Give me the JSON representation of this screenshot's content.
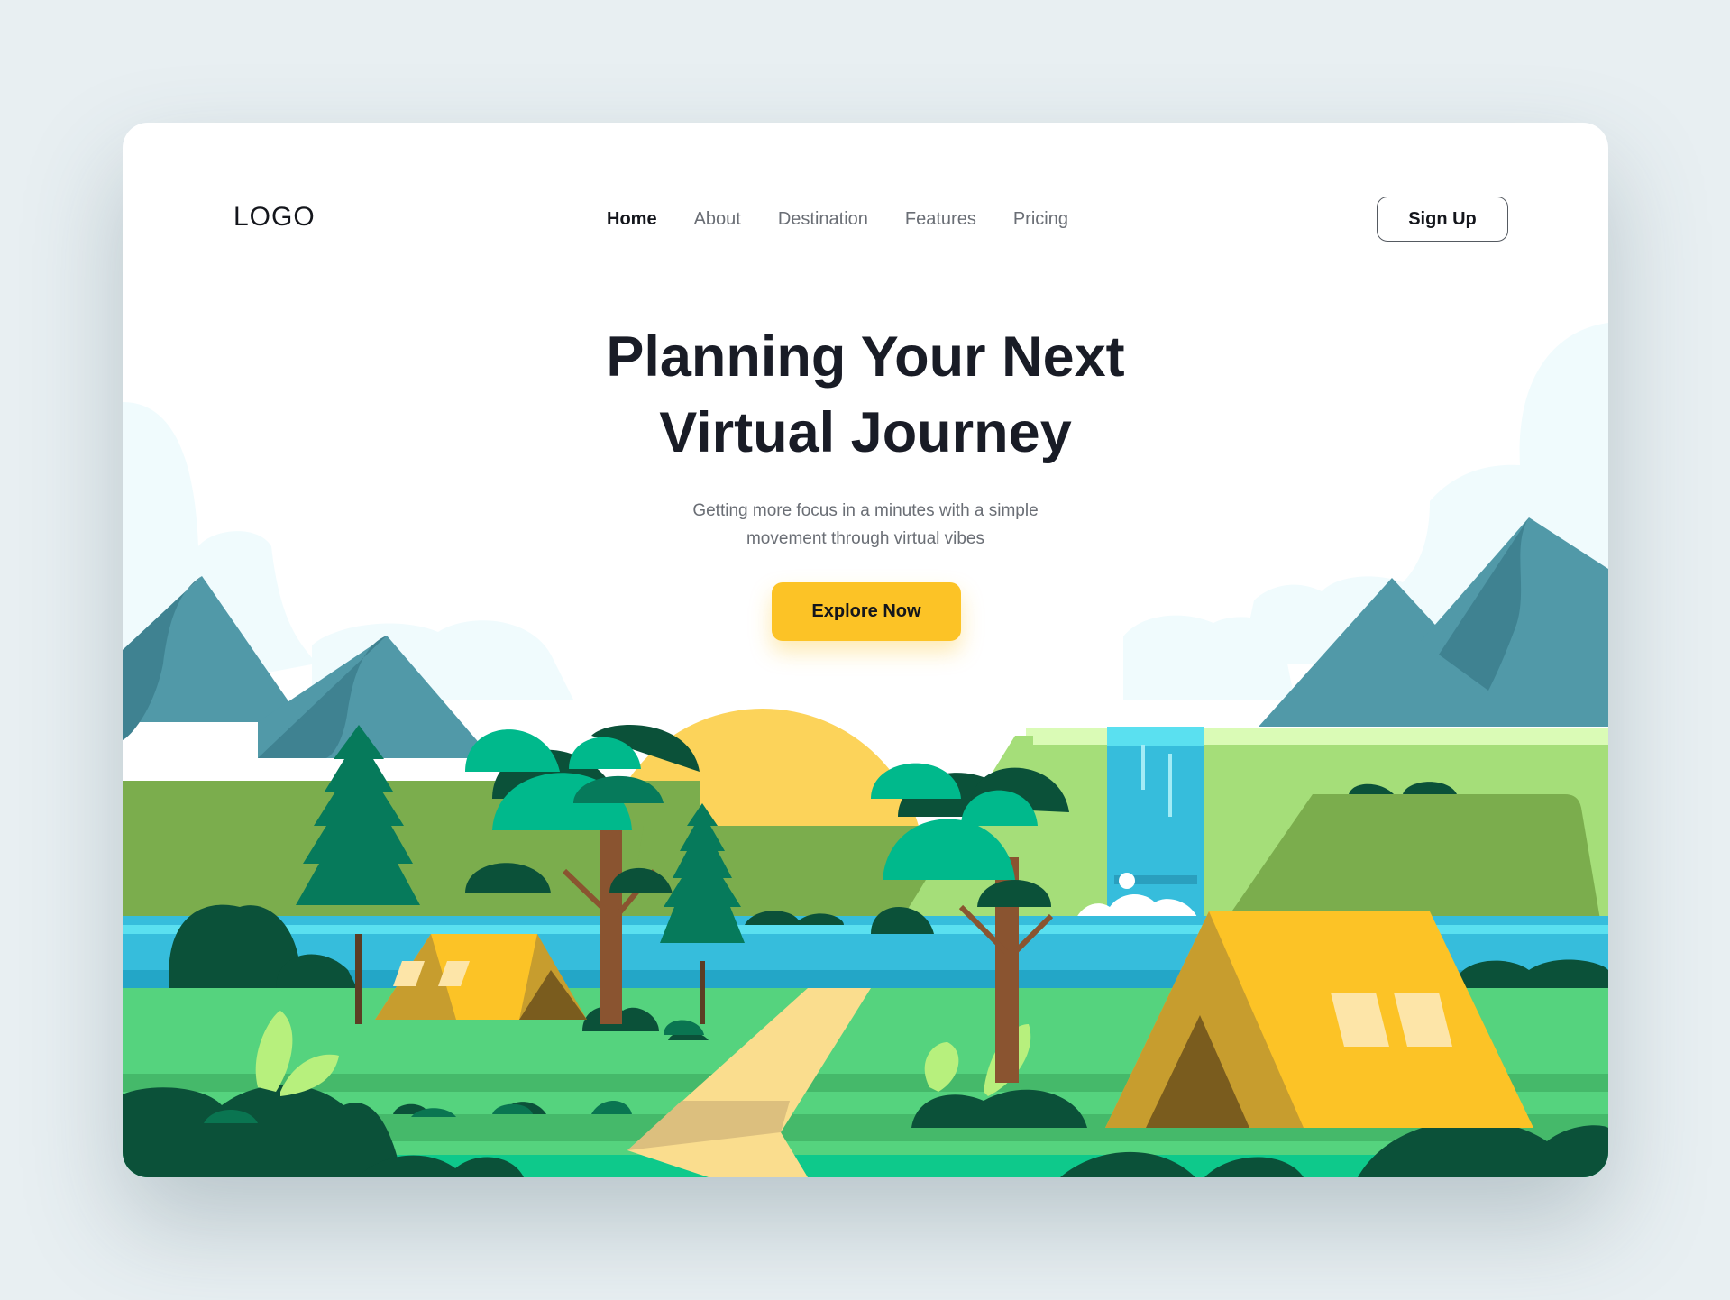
{
  "header": {
    "logo": "LOGO",
    "nav": [
      {
        "label": "Home",
        "active": true
      },
      {
        "label": "About",
        "active": false
      },
      {
        "label": "Destination",
        "active": false
      },
      {
        "label": "Features",
        "active": false
      },
      {
        "label": "Pricing",
        "active": false
      }
    ],
    "signup_label": "Sign Up"
  },
  "hero": {
    "title_line1": "Planning Your Next",
    "title_line2": "Virtual Journey",
    "subtitle_line1": "Getting more focus in a minutes with a simple",
    "subtitle_line2": "movement through virtual vibes",
    "cta_label": "Explore Now"
  },
  "colors": {
    "page_background": "#e8eff2",
    "card_background": "#ffffff",
    "accent_yellow": "#fcc326",
    "heading_text": "#191c26",
    "muted_text": "#6a6e75",
    "mountain": "#5199a8",
    "grass": "#55d37e",
    "river": "#36bddc",
    "dark_foliage": "#0b5139"
  },
  "illustration": {
    "scene": "camping landscape",
    "icons": [
      "mountain-icon",
      "sun-icon",
      "tree-icon",
      "tent-icon",
      "waterfall-icon",
      "river-icon",
      "bush-icon"
    ]
  }
}
